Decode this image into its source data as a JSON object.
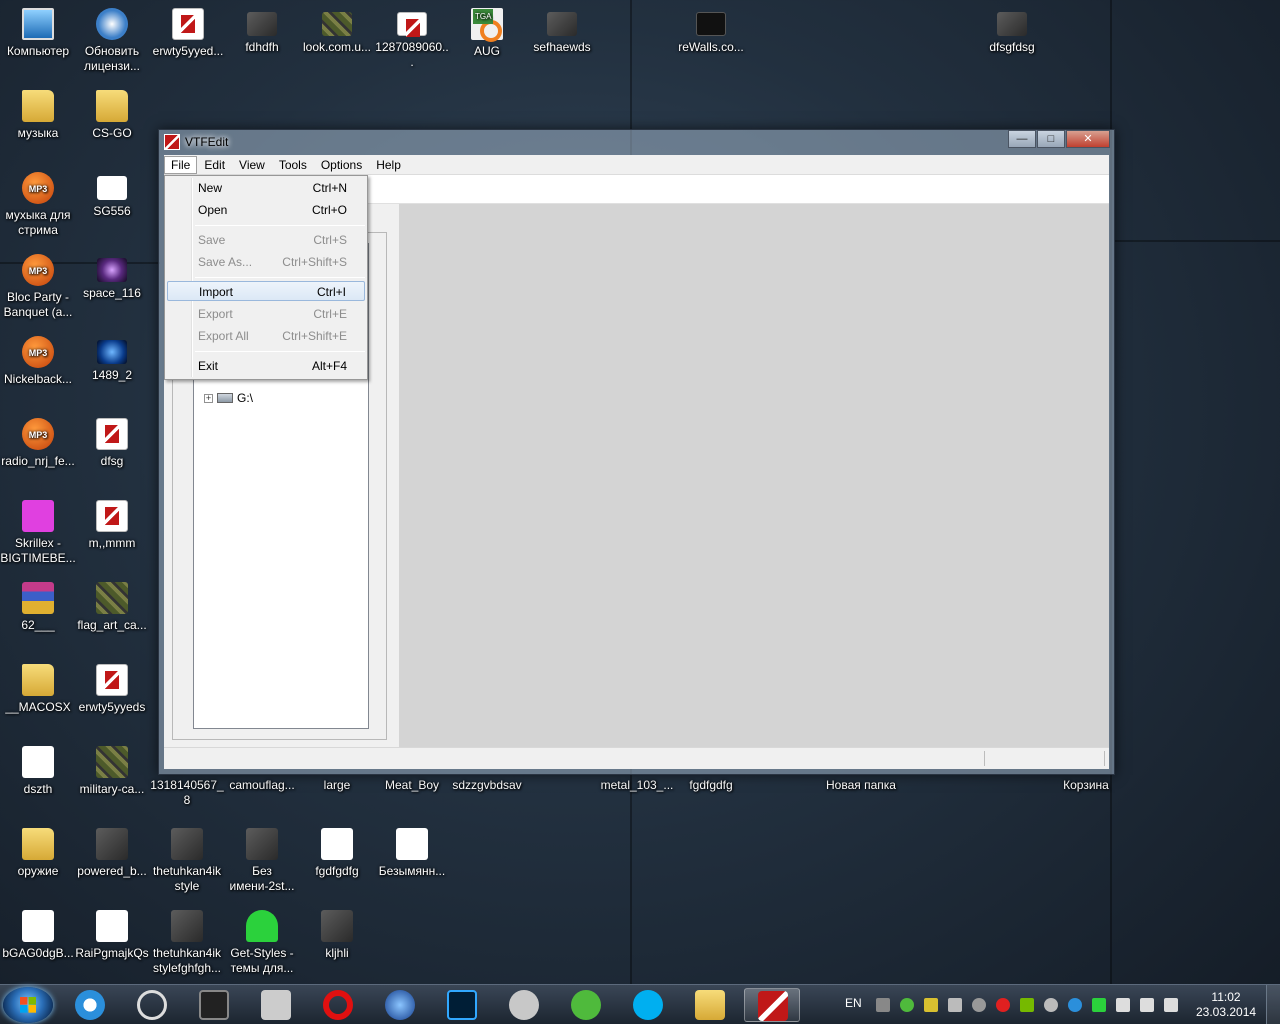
{
  "desktop": {
    "icons": [
      {
        "label": "Компьютер",
        "icon": "computer-icon"
      },
      {
        "label": "Обновить лицензи...",
        "icon": "update-license-icon"
      },
      {
        "label": "erwty5yyed...",
        "icon": "vtf-file-icon"
      },
      {
        "label": "fdhdfh",
        "icon": "image-thumbnail-icon"
      },
      {
        "label": "look.com.u...",
        "icon": "image-thumbnail-icon"
      },
      {
        "label": "1287089060...",
        "icon": "image-thumbnail-icon"
      },
      {
        "label": "AUG",
        "icon": "tga-file-icon"
      },
      {
        "label": "sefhaewds",
        "icon": "image-thumbnail-icon"
      },
      {
        "label": "reWalls.co...",
        "icon": "image-thumbnail-icon"
      },
      {
        "label": "dfsgfdsg",
        "icon": "image-thumbnail-icon"
      },
      {
        "label": "музыка",
        "icon": "folder-icon"
      },
      {
        "label": "CS-GO",
        "icon": "folder-icon"
      },
      {
        "label": "мухыка для стрима",
        "icon": "media-folder-icon"
      },
      {
        "label": "SG556",
        "icon": "image-thumbnail-icon"
      },
      {
        "label": "Bloc Party - Banquet  (a...",
        "icon": "mp3-icon"
      },
      {
        "label": "space_116",
        "icon": "image-thumbnail-icon"
      },
      {
        "label": "Nickelback...",
        "icon": "mp3-icon"
      },
      {
        "label": "1489_2",
        "icon": "image-thumbnail-icon"
      },
      {
        "label": "radio_nrj_fe...",
        "icon": "mp3-icon"
      },
      {
        "label": "dfsg",
        "icon": "image-thumbnail-icon"
      },
      {
        "label": "Skrillex - BIGTIMEBE...",
        "icon": "image-thumbnail-icon"
      },
      {
        "label": "m,,mmm",
        "icon": "vtf-file-icon"
      },
      {
        "label": "62___",
        "icon": "archive-icon"
      },
      {
        "label": "flag_art_ca...",
        "icon": "image-thumbnail-icon"
      },
      {
        "label": "__MACOSX",
        "icon": "folder-icon"
      },
      {
        "label": "erwty5yyeds",
        "icon": "vtf-file-icon"
      },
      {
        "label": "dszth",
        "icon": "image-thumbnail-icon"
      },
      {
        "label": "military-ca...",
        "icon": "image-thumbnail-icon"
      },
      {
        "label": "1318140567_8",
        "icon": "image-thumbnail-icon"
      },
      {
        "label": "camouflag...",
        "icon": "image-thumbnail-icon"
      },
      {
        "label": "large",
        "icon": "image-thumbnail-icon"
      },
      {
        "label": "Meat_Boy",
        "icon": "image-thumbnail-icon"
      },
      {
        "label": "sdzzgvbdsav",
        "icon": "image-thumbnail-icon"
      },
      {
        "label": "metal_103_...",
        "icon": "image-thumbnail-icon"
      },
      {
        "label": "fgdfgdfg",
        "icon": "image-thumbnail-icon"
      },
      {
        "label": "Новая папка",
        "icon": "folder-icon"
      },
      {
        "label": "Корзина",
        "icon": "recycle-bin-icon"
      },
      {
        "label": "оружие",
        "icon": "folder-icon"
      },
      {
        "label": "powered_b...",
        "icon": "image-thumbnail-icon"
      },
      {
        "label": "thetuhkan4ik style",
        "icon": "image-thumbnail-icon"
      },
      {
        "label": "Без имени-2st...",
        "icon": "image-thumbnail-icon"
      },
      {
        "label": "fgdfgdfg",
        "icon": "image-thumbnail-icon"
      },
      {
        "label": "Безымянн...",
        "icon": "image-thumbnail-icon"
      },
      {
        "label": "bGAG0dgB...",
        "icon": "image-thumbnail-icon"
      },
      {
        "label": "RaiPgmajkQs",
        "icon": "image-thumbnail-icon"
      },
      {
        "label": "thetuhkan4ik stylefghfgh...",
        "icon": "image-thumbnail-icon"
      },
      {
        "label": "Get-Styles - темы для...",
        "icon": "shortcut-icon"
      },
      {
        "label": "kljhli",
        "icon": "image-thumbnail-icon"
      }
    ]
  },
  "window": {
    "title": "VTFEdit",
    "menu": [
      "File",
      "Edit",
      "View",
      "Tools",
      "Options",
      "Help"
    ],
    "tree": {
      "drive_label": "G:\\"
    }
  },
  "file_menu": {
    "items": [
      {
        "label": "New",
        "shortcut": "Ctrl+N",
        "enabled": true
      },
      {
        "label": "Open",
        "shortcut": "Ctrl+O",
        "enabled": true
      },
      {
        "label": "Save",
        "shortcut": "Ctrl+S",
        "enabled": false
      },
      {
        "label": "Save As...",
        "shortcut": "Ctrl+Shift+S",
        "enabled": false
      },
      {
        "label": "Import",
        "shortcut": "Ctrl+I",
        "enabled": true,
        "highlighted": true
      },
      {
        "label": "Export",
        "shortcut": "Ctrl+E",
        "enabled": false
      },
      {
        "label": "Export All",
        "shortcut": "Ctrl+Shift+E",
        "enabled": false
      },
      {
        "label": "Exit",
        "shortcut": "Alt+F4",
        "enabled": true
      }
    ]
  },
  "taskbar": {
    "pinned": [
      "uTorrent-like app",
      "steam",
      "photoshop",
      "opera",
      "skype",
      "explorer",
      "vtfedit"
    ],
    "language": "EN",
    "time": "11:02",
    "date": "23.03.2014"
  },
  "colors": {
    "menu_highlight_border": "#9ab8dc",
    "viewport_bg": "#d4d4d4",
    "desktop_bg": "#22303f"
  }
}
